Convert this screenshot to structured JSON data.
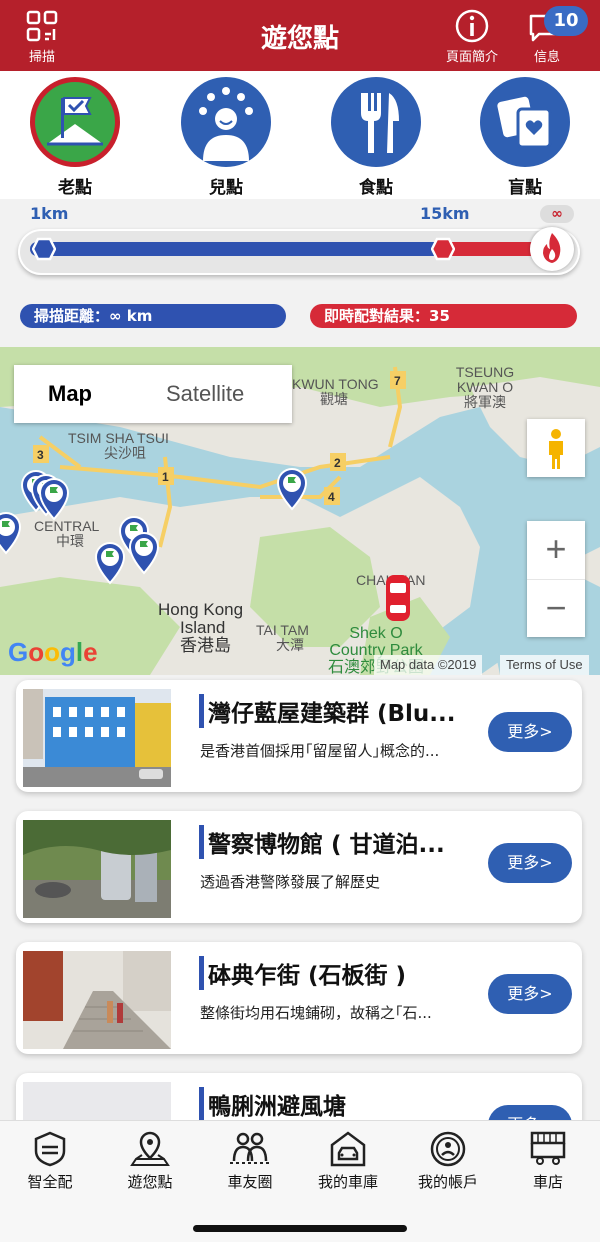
{
  "header": {
    "title": "遊您點",
    "scan_label": "掃描",
    "page_intro_label": "頁面簡介",
    "messages_label": "信息",
    "messages_badge": "10"
  },
  "categories": [
    {
      "label": "老點",
      "active": true
    },
    {
      "label": "兒點",
      "active": false
    },
    {
      "label": "食點",
      "active": false
    },
    {
      "label": "盲點",
      "active": false
    }
  ],
  "range": {
    "min_label": "1km",
    "max_label": "15km",
    "infinity_label": "∞",
    "scan_distance": "掃描距離：∞ km",
    "match_result": "即時配對結果：35"
  },
  "map": {
    "type_map": "Map",
    "type_satellite": "Satellite",
    "labels": [
      "TSEUNG",
      "KWAN O",
      "將軍澳",
      "KWUN TONG",
      "觀塘",
      "TSIM SHA TSUI",
      "尖沙咀",
      "CENTRAL",
      "中環",
      "Hong Kong",
      "Island",
      "香港島",
      "TAI TAM",
      "大潭",
      "CHAI WAN",
      "Shek O",
      "Country Park",
      "石澳郊野公園"
    ],
    "route_numbers": [
      "3",
      "1",
      "2",
      "4",
      "7"
    ],
    "zoom_in": "+",
    "zoom_out": "−",
    "google": "Google",
    "map_data": "Map data ©2019",
    "terms": "Terms of Use"
  },
  "places": [
    {
      "title": "灣仔藍屋建築群 (Blu...",
      "desc": "是香港首個採用｢留屋留人｣概念的...",
      "more": "更多>"
    },
    {
      "title": "警察博物館 ( 甘道泊...",
      "desc": "透過香港警隊發展了解歷史",
      "more": "更多>"
    },
    {
      "title": "砵典乍街 (石板街 )",
      "desc": "整條街均用石塊鋪砌，故稱之｢石...",
      "more": "更多>"
    },
    {
      "title": "鴨脷洲避風塘",
      "desc": "",
      "more": "更多>"
    }
  ],
  "tabs": [
    {
      "label": "智全配"
    },
    {
      "label": "遊您點"
    },
    {
      "label": "車友圈"
    },
    {
      "label": "我的車庫"
    },
    {
      "label": "我的帳戶"
    },
    {
      "label": "車店"
    }
  ]
}
